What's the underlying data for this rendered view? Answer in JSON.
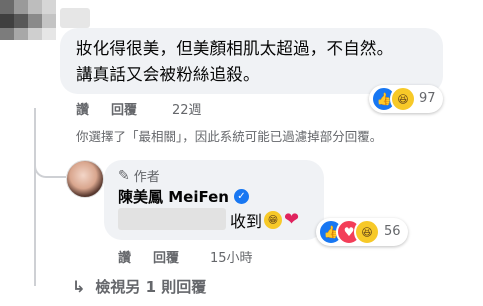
{
  "comment": {
    "lines": [
      "妝化得很美，但美顏相肌太超過，不自然。",
      "講真話又会被粉絲追殺。"
    ],
    "reaction_count": "97",
    "actions": {
      "like": "讚",
      "reply": "回覆",
      "time": "22週"
    },
    "notice": "你選擇了「最相關」，因此系統可能已過濾掉部分回覆。"
  },
  "reply": {
    "author_tag": "作者",
    "name": "陳美鳳 MeiFen",
    "text": "收到",
    "reaction_count": "56",
    "actions": {
      "like": "讚",
      "reply": "回覆",
      "time": "15小時"
    }
  },
  "more_replies": {
    "label": "檢視另 1 則回覆"
  },
  "icons": {
    "like": "thumbs-up-icon",
    "haha": "laughing-face-icon",
    "love": "heart-icon",
    "pen": "pen-icon",
    "verified": "verified-check-icon",
    "reply_arrow": "reply-arrow-icon"
  },
  "colors": {
    "facebook_blue": "#1877f2",
    "bubble_gray": "#f0f2f5",
    "meta_gray": "#65676b",
    "love_red": "#f33e58"
  }
}
